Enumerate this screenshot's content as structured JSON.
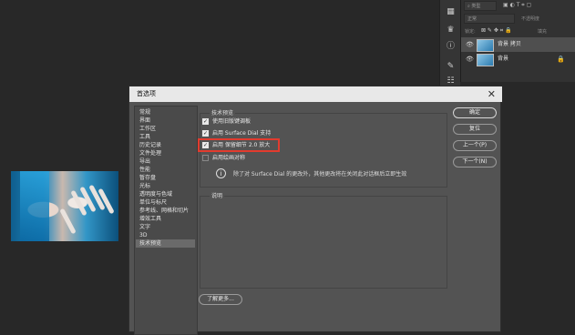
{
  "layers_panel": {
    "search_placeholder": "类型",
    "blend_mode": "正常",
    "opacity_label": "不透明度",
    "lock_label": "锁定:",
    "fill_label": "填充",
    "layers": [
      {
        "name": "背景 拷贝",
        "selected": true
      },
      {
        "name": "背景",
        "locked": true
      }
    ]
  },
  "dialog": {
    "title": "首选项",
    "close_glyph": "✕",
    "categories": [
      "常规",
      "界面",
      "工作区",
      "工具",
      "历史记录",
      "文件处理",
      "导出",
      "性能",
      "暂存盘",
      "光标",
      "透明度与色域",
      "单位与标尺",
      "参考线、网格和切片",
      "增效工具",
      "文字",
      "3D",
      "技术预览"
    ],
    "selected_category": "技术预览",
    "section_title": "技术预览",
    "options": [
      {
        "label": "使用旧版键调板",
        "checked": true
      },
      {
        "label": "启用 Surface Dial 支持",
        "checked": true
      },
      {
        "label": "启用 保留细节 2.0 放大",
        "checked": true
      },
      {
        "label": "启用绘画对称",
        "checked": false
      }
    ],
    "info_glyph": "i",
    "note": "除了对 Surface Dial 的更改外，其他更改将在关闭此对话框后立即生效",
    "description_title": "说明",
    "buttons": {
      "ok": "确定",
      "reset": "复位",
      "prev": "上一个(P)",
      "next": "下一个(N)"
    },
    "learn_more": "了解更多..."
  },
  "colors": {
    "highlight": "#e23b2e",
    "dialog_bg": "#535353",
    "titlebar_bg": "#e8e8e8"
  }
}
